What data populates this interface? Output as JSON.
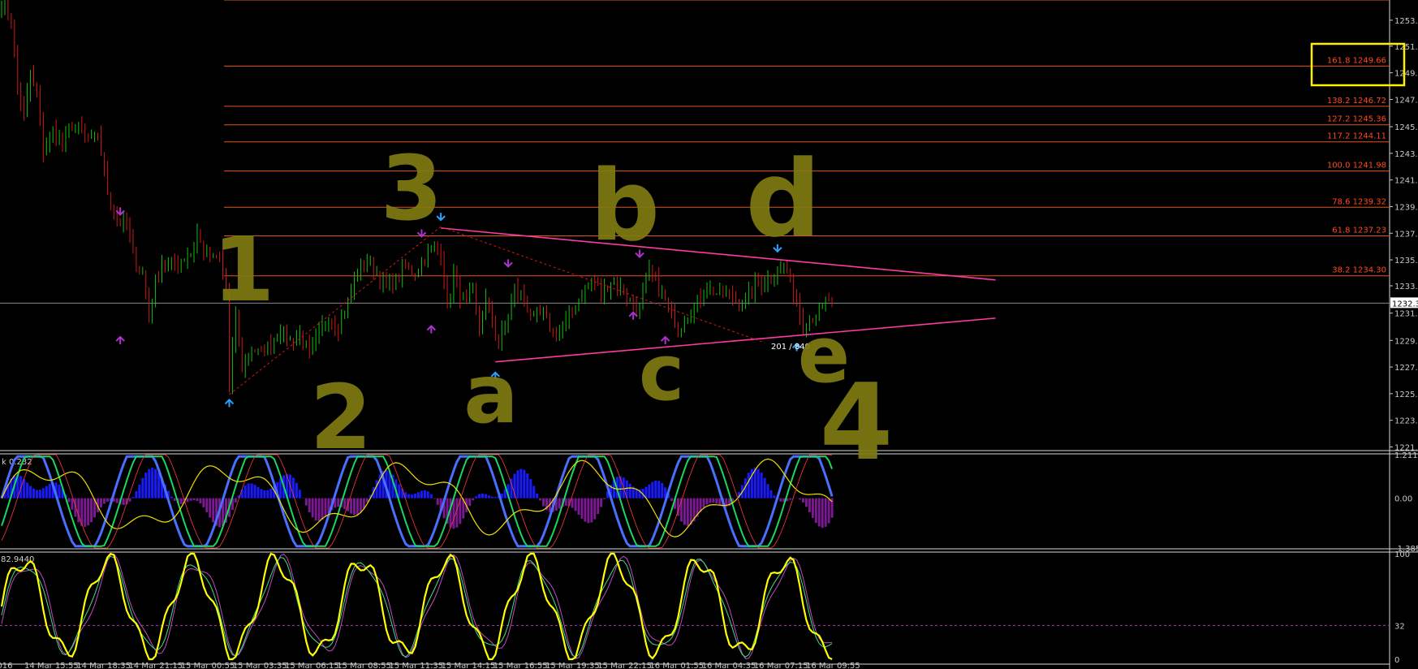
{
  "chart_data": {
    "type": "candlestick",
    "price_axis": {
      "range": [
        1221.5,
        1254.5
      ],
      "ticks": [
        "1253.02",
        "1251.12",
        "1249.17",
        "1247.22",
        "1245.22",
        "1243.27",
        "1241.32",
        "1239.37",
        "1237.42",
        "1235.47",
        "1233.57",
        "1231.57",
        "1229.57",
        "1227.62",
        "1225.67",
        "1223.72",
        "1221.77"
      ],
      "tick_values": [
        1253.02,
        1251.12,
        1249.17,
        1247.22,
        1245.22,
        1243.27,
        1241.32,
        1239.37,
        1237.42,
        1235.47,
        1233.57,
        1231.57,
        1229.57,
        1227.62,
        1225.67,
        1223.72,
        1221.77
      ],
      "current_price_label": "1232.3",
      "current_price": 1232.3
    },
    "time_axis": {
      "labels": [
        "2016",
        "14 Mar 15:55",
        "14 Mar 18:35",
        "14 Mar 21:15",
        "15 Mar 00:55",
        "15 Mar 03:35",
        "15 Mar 06:15",
        "15 Mar 08:55",
        "15 Mar 11:35",
        "15 Mar 14:15",
        "15 Mar 16:55",
        "15 Mar 19:35",
        "15 Mar 22:15",
        "16 Mar 01:55",
        "16 Mar 04:35",
        "16 Mar 07:15",
        "16 Mar 09:55"
      ]
    },
    "fib_levels": [
      {
        "label": "161.8 1249.66",
        "value": 1249.66
      },
      {
        "label": "138.2 1246.72",
        "value": 1246.72
      },
      {
        "label": "127.2 1245.36",
        "value": 1245.36
      },
      {
        "label": "117.2 1244.11",
        "value": 1244.11
      },
      {
        "label": "100.0    1241.98",
        "value": 1241.98
      },
      {
        "label": "78.6 1239.32",
        "value": 1239.32
      },
      {
        "label": "61.8 1237.23",
        "value": 1237.23
      },
      {
        "label": "38.2 1234.30",
        "value": 1234.3
      }
    ],
    "extra_levels": [
      1254.5
    ],
    "price_path": [
      [
        0,
        1254.3
      ],
      [
        3,
        1253.0
      ],
      [
        5,
        1248.0
      ],
      [
        7,
        1246.0
      ],
      [
        9,
        1249.0
      ],
      [
        11,
        1247.5
      ],
      [
        13,
        1243.5
      ],
      [
        16,
        1245.0
      ],
      [
        19,
        1244.0
      ],
      [
        22,
        1245.5
      ],
      [
        25,
        1244.8
      ],
      [
        28,
        1244.0
      ],
      [
        30,
        1244.8
      ],
      [
        33,
        1240.5
      ],
      [
        36,
        1238.5
      ],
      [
        39,
        1238.0
      ],
      [
        42,
        1235.0
      ],
      [
        44,
        1234.5
      ],
      [
        46,
        1231.5
      ],
      [
        48,
        1234.0
      ],
      [
        50,
        1235.5
      ],
      [
        53,
        1235.0
      ],
      [
        56,
        1235.5
      ],
      [
        59,
        1236.0
      ],
      [
        61,
        1237.5
      ],
      [
        63,
        1236.0
      ],
      [
        66,
        1235.5
      ],
      [
        68,
        1235.5
      ],
      [
        70,
        1233.5
      ],
      [
        71,
        1226.0
      ],
      [
        73,
        1231.5
      ],
      [
        75,
        1227.5
      ],
      [
        78,
        1229.0
      ],
      [
        81,
        1228.5
      ],
      [
        84,
        1229.5
      ],
      [
        87,
        1230.5
      ],
      [
        90,
        1229.5
      ],
      [
        93,
        1230.0
      ],
      [
        96,
        1228.5
      ],
      [
        99,
        1230.0
      ],
      [
        102,
        1231.5
      ],
      [
        105,
        1230.5
      ],
      [
        108,
        1232.5
      ],
      [
        111,
        1234.5
      ],
      [
        114,
        1235.5
      ],
      [
        117,
        1234.5
      ],
      [
        120,
        1233.5
      ],
      [
        123,
        1234.0
      ],
      [
        126,
        1235.0
      ],
      [
        129,
        1234.5
      ],
      [
        132,
        1235.5
      ],
      [
        135,
        1236.5
      ],
      [
        137,
        1236.0
      ],
      [
        139,
        1232.0
      ],
      [
        141,
        1234.5
      ],
      [
        143,
        1233.0
      ],
      [
        145,
        1232.5
      ],
      [
        147,
        1233.0
      ],
      [
        149,
        1230.5
      ],
      [
        151,
        1232.5
      ],
      [
        153,
        1231.0
      ],
      [
        155,
        1229.5
      ],
      [
        157,
        1230.5
      ],
      [
        160,
        1233.5
      ],
      [
        163,
        1232.5
      ],
      [
        166,
        1231.0
      ],
      [
        169,
        1231.5
      ],
      [
        172,
        1230.0
      ],
      [
        175,
        1230.5
      ],
      [
        178,
        1231.5
      ],
      [
        181,
        1233.0
      ],
      [
        184,
        1234.0
      ],
      [
        187,
        1233.0
      ],
      [
        190,
        1234.0
      ],
      [
        193,
        1233.5
      ],
      [
        196,
        1232.5
      ],
      [
        199,
        1232.0
      ],
      [
        202,
        1234.5
      ],
      [
        205,
        1233.5
      ],
      [
        208,
        1232.0
      ],
      [
        211,
        1230.5
      ],
      [
        214,
        1231.5
      ],
      [
        217,
        1232.5
      ],
      [
        220,
        1233.5
      ],
      [
        223,
        1233.0
      ],
      [
        226,
        1233.0
      ],
      [
        229,
        1232.5
      ],
      [
        232,
        1232.5
      ],
      [
        235,
        1233.5
      ],
      [
        238,
        1234.0
      ],
      [
        241,
        1234.5
      ],
      [
        244,
        1235.0
      ],
      [
        246,
        1234.0
      ],
      [
        248,
        1232.5
      ],
      [
        250,
        1230.5
      ],
      [
        252,
        1231.0
      ],
      [
        254,
        1231.5
      ],
      [
        256,
        1232.0
      ],
      [
        258,
        1232.5
      ],
      [
        259,
        1232.4
      ]
    ],
    "wave_labels": [
      "1",
      "2",
      "3",
      "a",
      "b",
      "c",
      "d",
      "e",
      "4"
    ],
    "annotation": "201 / 840",
    "triangle_lines": [
      {
        "from": [
          137,
          1237.8
        ],
        "to": [
          310,
          1234.0
        ]
      },
      {
        "from": [
          154,
          1228.0
        ],
        "to": [
          310,
          1231.2
        ]
      }
    ],
    "osc1": {
      "label": "k 0.232",
      "ticks": [
        "1.211",
        "0.00",
        "-1.385"
      ],
      "range": [
        -1.385,
        1.211
      ]
    },
    "osc2": {
      "label": "82.9440",
      "ticks": [
        "100",
        "32",
        "0"
      ],
      "range": [
        0,
        100
      ]
    }
  }
}
